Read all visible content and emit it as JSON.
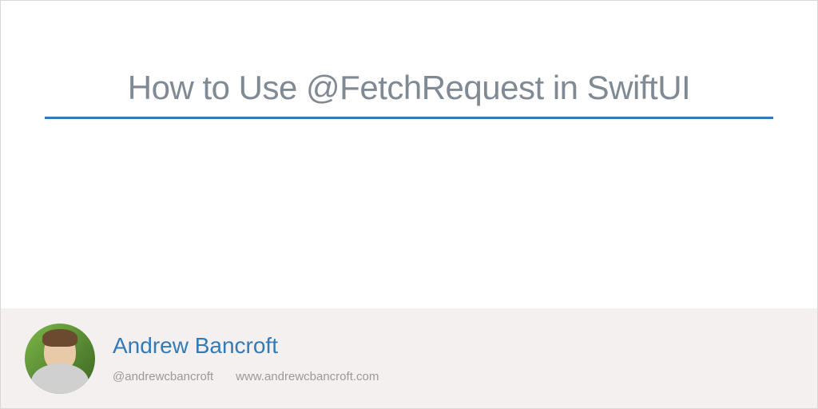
{
  "title": "How to Use @FetchRequest in SwiftUI",
  "author": {
    "name": "Andrew Bancroft",
    "handle": "@andrewcbancroft",
    "website": "www.andrewcbancroft.com"
  },
  "colors": {
    "accent": "#337ab7",
    "titleText": "#808a94",
    "footerBg": "#f4f0f0",
    "metaText": "#9a9a9a"
  }
}
